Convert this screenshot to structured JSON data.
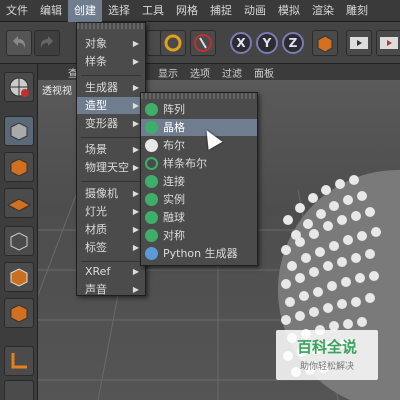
{
  "menubar": {
    "items": [
      "文件",
      "编辑",
      "创建",
      "选择",
      "工具",
      "网格",
      "捕捉",
      "动画",
      "模拟",
      "渲染",
      "雕刻"
    ],
    "active_index": 2
  },
  "toolbar": {
    "axes": [
      "X",
      "Y",
      "Z"
    ]
  },
  "viewport": {
    "label": "透视视",
    "header": [
      "查",
      "显示",
      "选项",
      "过滤",
      "面板"
    ]
  },
  "create_menu": {
    "items": [
      {
        "label": "对象",
        "submenu": true
      },
      {
        "label": "样条",
        "submenu": true
      },
      {
        "label": "生成器",
        "submenu": true
      },
      {
        "label": "造型",
        "submenu": true,
        "highlighted": true
      },
      {
        "label": "变形器",
        "submenu": true
      },
      {
        "label": "场景",
        "submenu": true
      },
      {
        "label": "物理天空",
        "submenu": true
      },
      {
        "label": "摄像机",
        "submenu": true
      },
      {
        "label": "灯光",
        "submenu": true
      },
      {
        "label": "材质",
        "submenu": true
      },
      {
        "label": "标签",
        "submenu": true
      },
      {
        "label": "XRef",
        "submenu": true
      },
      {
        "label": "声音",
        "submenu": true
      }
    ]
  },
  "modeling_submenu": {
    "items": [
      {
        "label": "阵列",
        "icon": "array-icon"
      },
      {
        "label": "晶格",
        "icon": "lattice-icon",
        "highlighted": true
      },
      {
        "label": "布尔",
        "icon": "boole-icon"
      },
      {
        "label": "样条布尔",
        "icon": "spline-boole-icon"
      },
      {
        "label": "连接",
        "icon": "connect-icon"
      },
      {
        "label": "实例",
        "icon": "instance-icon"
      },
      {
        "label": "融球",
        "icon": "metaball-icon"
      },
      {
        "label": "对称",
        "icon": "symmetry-icon"
      },
      {
        "label": "Python 生成器",
        "icon": "python-generator-icon"
      }
    ]
  },
  "watermark": {
    "title": "百科全说",
    "subtitle": "助你轻松解决"
  },
  "colors": {
    "highlight": "#6f7d8f",
    "menu_bg": "#4b4b4b",
    "icon_green": "#3fae6b"
  }
}
